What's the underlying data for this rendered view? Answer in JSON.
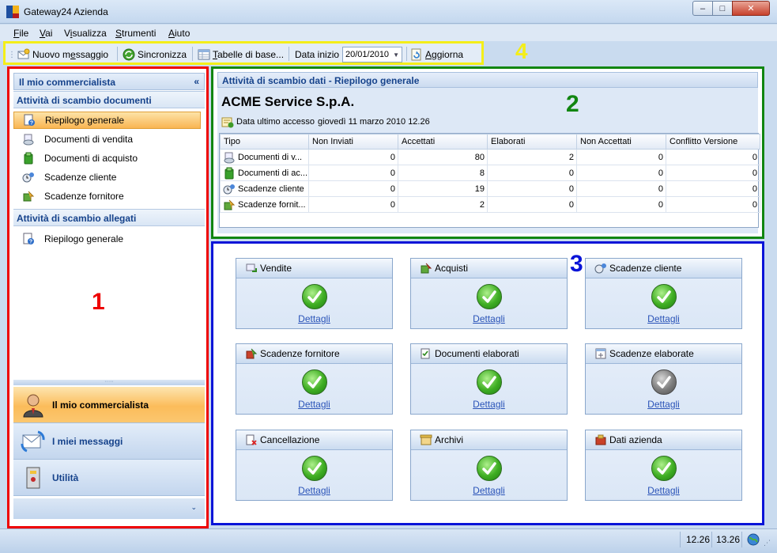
{
  "window": {
    "title": "Gateway24 Azienda",
    "min": "–",
    "max": "□",
    "close": "✕"
  },
  "menu": [
    {
      "label": "File"
    },
    {
      "label": "Vai"
    },
    {
      "label": "Visualizza"
    },
    {
      "label": "Strumenti"
    },
    {
      "label": "Aiuto"
    }
  ],
  "toolbar": {
    "new_message": "Nuovo messaggio",
    "sync": "Sincronizza",
    "base_tables": "Tabelle di base...",
    "start_date_label": "Data inizio",
    "start_date_value": "20/01/2010",
    "refresh": "Aggiorna"
  },
  "annotations": {
    "one": "1",
    "two": "2",
    "three": "3",
    "four": "4"
  },
  "nav": {
    "header": "Il mio commercialista",
    "collapse": "«",
    "group_documents": "Attività di scambio documenti",
    "documents_items": [
      {
        "label": "Riepilogo generale",
        "icon": "summary-icon"
      },
      {
        "label": "Documenti di vendita",
        "icon": "sales-documents-icon"
      },
      {
        "label": "Documenti di acquisto",
        "icon": "purchase-documents-icon"
      },
      {
        "label": "Scadenze cliente",
        "icon": "customer-deadlines-icon"
      },
      {
        "label": "Scadenze fornitore",
        "icon": "supplier-deadlines-icon"
      }
    ],
    "group_attachments": "Attività di scambio allegati",
    "attachments_items": [
      {
        "label": "Riepilogo generale",
        "icon": "summary-icon"
      }
    ],
    "splitter": "·····",
    "big_items": [
      {
        "label": "Il mio commercialista",
        "icon": "accountant-icon"
      },
      {
        "label": "I miei messaggi",
        "icon": "messages-icon"
      },
      {
        "label": "Utilità",
        "icon": "utilities-icon"
      }
    ],
    "footer_chevron": "⌄"
  },
  "summary": {
    "header": "Attività di scambio dati - Riepilogo generale",
    "company": "ACME Service S.p.A.",
    "last_access_label": "Data ultimo accesso",
    "last_access_value": "giovedì 11 marzo 2010 12.26",
    "columns": [
      "Tipo",
      "Non Inviati",
      "Accettati",
      "Elaborati",
      "Non Accettati",
      "Conflitto Versione"
    ],
    "rows": [
      {
        "tipo": "Documenti di v...",
        "non_inviati": "0",
        "accettati": "80",
        "elaborati": "2",
        "non_accettati": "0",
        "conflitto": "0"
      },
      {
        "tipo": "Documenti di ac...",
        "non_inviati": "0",
        "accettati": "8",
        "elaborati": "0",
        "non_accettati": "0",
        "conflitto": "0"
      },
      {
        "tipo": "Scadenze cliente",
        "non_inviati": "0",
        "accettati": "19",
        "elaborati": "0",
        "non_accettati": "0",
        "conflitto": "0"
      },
      {
        "tipo": "Scadenze fornit...",
        "non_inviati": "0",
        "accettati": "2",
        "elaborati": "0",
        "non_accettati": "0",
        "conflitto": "0"
      }
    ]
  },
  "dashboard": {
    "cards": [
      {
        "title": "Vendite",
        "icon": "sales-icon",
        "status": "ok",
        "link": "Dettagli"
      },
      {
        "title": "Acquisti",
        "icon": "purchases-icon",
        "status": "ok",
        "link": "Dettagli"
      },
      {
        "title": "Scadenze cliente",
        "icon": "customer-deadlines-icon",
        "status": "ok",
        "link": "Dettagli"
      },
      {
        "title": "Scadenze fornitore",
        "icon": "supplier-deadlines-icon",
        "status": "ok",
        "link": "Dettagli"
      },
      {
        "title": "Documenti elaborati",
        "icon": "processed-documents-icon",
        "status": "ok",
        "link": "Dettagli"
      },
      {
        "title": "Scadenze elaborate",
        "icon": "processed-deadlines-icon",
        "status": "neutral",
        "link": "Dettagli"
      },
      {
        "title": "Cancellazione",
        "icon": "deletion-icon",
        "status": "ok",
        "link": "Dettagli"
      },
      {
        "title": "Archivi",
        "icon": "archives-icon",
        "status": "ok",
        "link": "Dettagli"
      },
      {
        "title": "Dati azienda",
        "icon": "company-data-icon",
        "status": "ok",
        "link": "Dettagli"
      }
    ]
  },
  "status": {
    "time1": "12.26",
    "time2": "13.26",
    "icon": "network-globe-icon"
  },
  "colors": {
    "accent_orange": "#fbbc5a",
    "panel_blue": "#15428b",
    "ok_green": "#3fae23",
    "link_blue": "#2a53b8"
  }
}
